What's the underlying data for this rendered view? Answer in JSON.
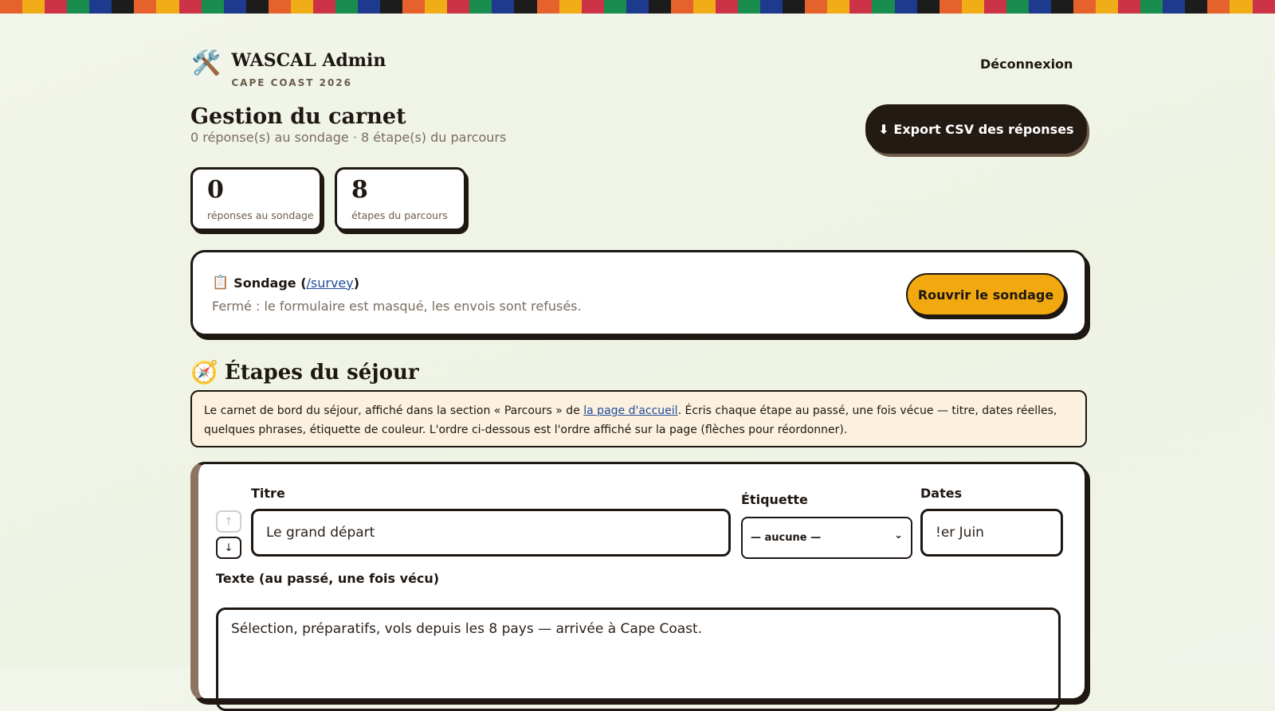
{
  "kente_colors": [
    "#e5622d",
    "#f0ad18",
    "#cc3347",
    "#198d4d",
    "#1d3a8f",
    "#1c1c1c"
  ],
  "header": {
    "icon": "hammer-wrench-icon",
    "title": "WASCAL Admin",
    "subtitle": "CAPE COAST 2026",
    "logout_label": "Déconnexion"
  },
  "main": {
    "title": "Gestion du carnet",
    "subtitle": "0 réponse(s) au sondage · 8 étape(s) du parcours",
    "export_label": "⬇ Export CSV des réponses"
  },
  "stats": [
    {
      "value": "0",
      "label": "réponses au sondage"
    },
    {
      "value": "8",
      "label": "étapes du parcours"
    }
  ],
  "survey": {
    "icon": "clipboard-icon",
    "title": "Sondage (",
    "link": "/survey",
    "title_end": ")",
    "status": "Fermé : le formulaire est masqué, les envois sont refusés.",
    "reopen_label": "Rouvrir le sondage"
  },
  "steps_section": {
    "icon": "compass-icon",
    "title": "Étapes du séjour",
    "info_before": "Le carnet de bord du séjour, affiché dans la section « Parcours » de ",
    "info_link": "la page d'accueil",
    "info_after": ". Écris chaque étape au passé, une fois vécue — titre, dates réelles, quelques phrases, étiquette de couleur. L'ordre ci-dessous est l'ordre affiché sur la page (flèches pour réordonner)."
  },
  "step": {
    "up_icon": "arrow-up-icon",
    "down_icon": "arrow-down-icon",
    "title_label": "Titre",
    "title_value": "Le grand départ",
    "tag_label": "Étiquette",
    "tag_value": "— aucune —",
    "dates_label": "Dates",
    "dates_value": "!er Juin",
    "text_label": "Texte (au passé, une fois vécu)",
    "text_value": "Sélection, préparatifs, vols depuis les 8 pays — arrivée à Cape Coast."
  }
}
